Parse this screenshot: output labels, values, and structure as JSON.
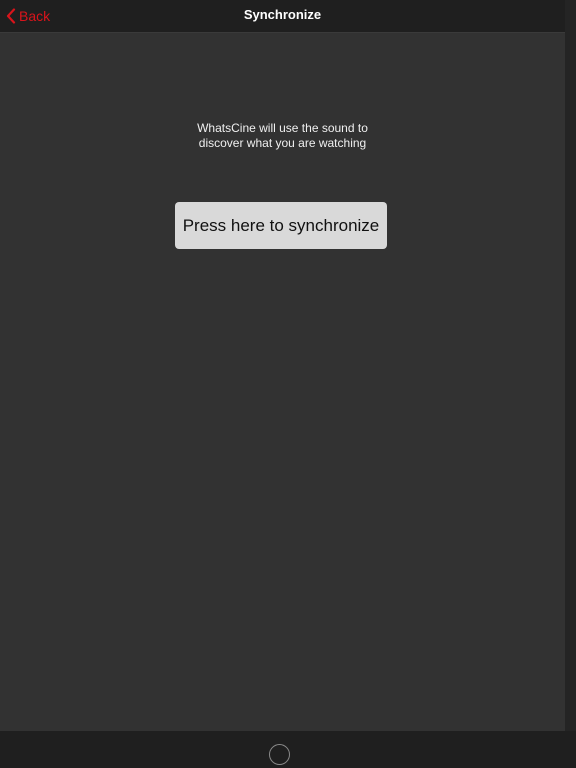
{
  "navbar": {
    "back_label": "Back",
    "title": "Synchronize"
  },
  "main": {
    "info_text": "WhatsCine will use the sound to\ndiscover what you are watching",
    "sync_button_label": "Press here to synchronize"
  },
  "icons": {
    "back": "chevron-left-icon",
    "home": "home-button-icon"
  },
  "colors": {
    "accent": "#d9141b",
    "background": "#323232",
    "navbar": "#1f1f1f",
    "button": "#d9d9d9"
  }
}
